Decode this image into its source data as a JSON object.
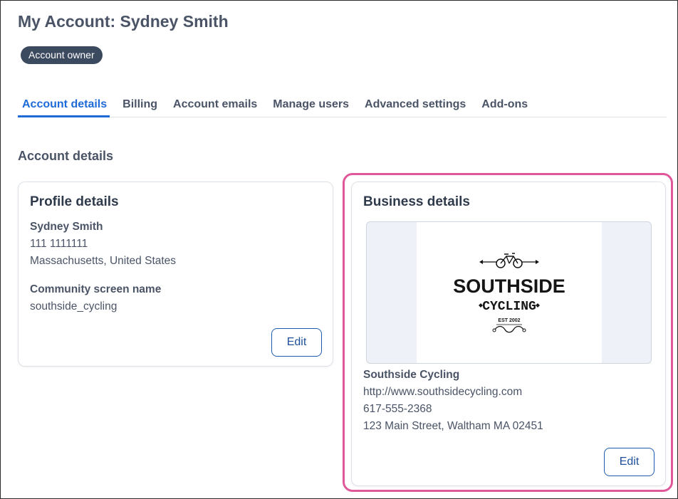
{
  "header": {
    "title": "My Account: Sydney Smith",
    "role_badge": "Account owner"
  },
  "tabs": [
    {
      "label": "Account details",
      "active": true
    },
    {
      "label": "Billing",
      "active": false
    },
    {
      "label": "Account emails",
      "active": false
    },
    {
      "label": "Manage users",
      "active": false
    },
    {
      "label": "Advanced settings",
      "active": false
    },
    {
      "label": "Add-ons",
      "active": false
    }
  ],
  "section_title": "Account details",
  "profile": {
    "title": "Profile details",
    "name": "Sydney Smith",
    "phone": "111 1111111",
    "location": "Massachusetts, United States",
    "screen_name_label": "Community screen name",
    "screen_name": "southside_cycling",
    "edit_label": "Edit"
  },
  "business": {
    "title": "Business details",
    "logo": {
      "brand": "SOUTHSIDE",
      "sub": "CYCLING",
      "est": "EST 2002"
    },
    "name": "Southside Cycling",
    "website": "http://www.southsidecycling.com",
    "phone": "617-555-2368",
    "address": "123 Main Street, Waltham MA 02451",
    "edit_label": "Edit"
  },
  "colors": {
    "accent": "#1e6ad8",
    "badge": "#3c4a60",
    "highlight": "#e0589a"
  }
}
